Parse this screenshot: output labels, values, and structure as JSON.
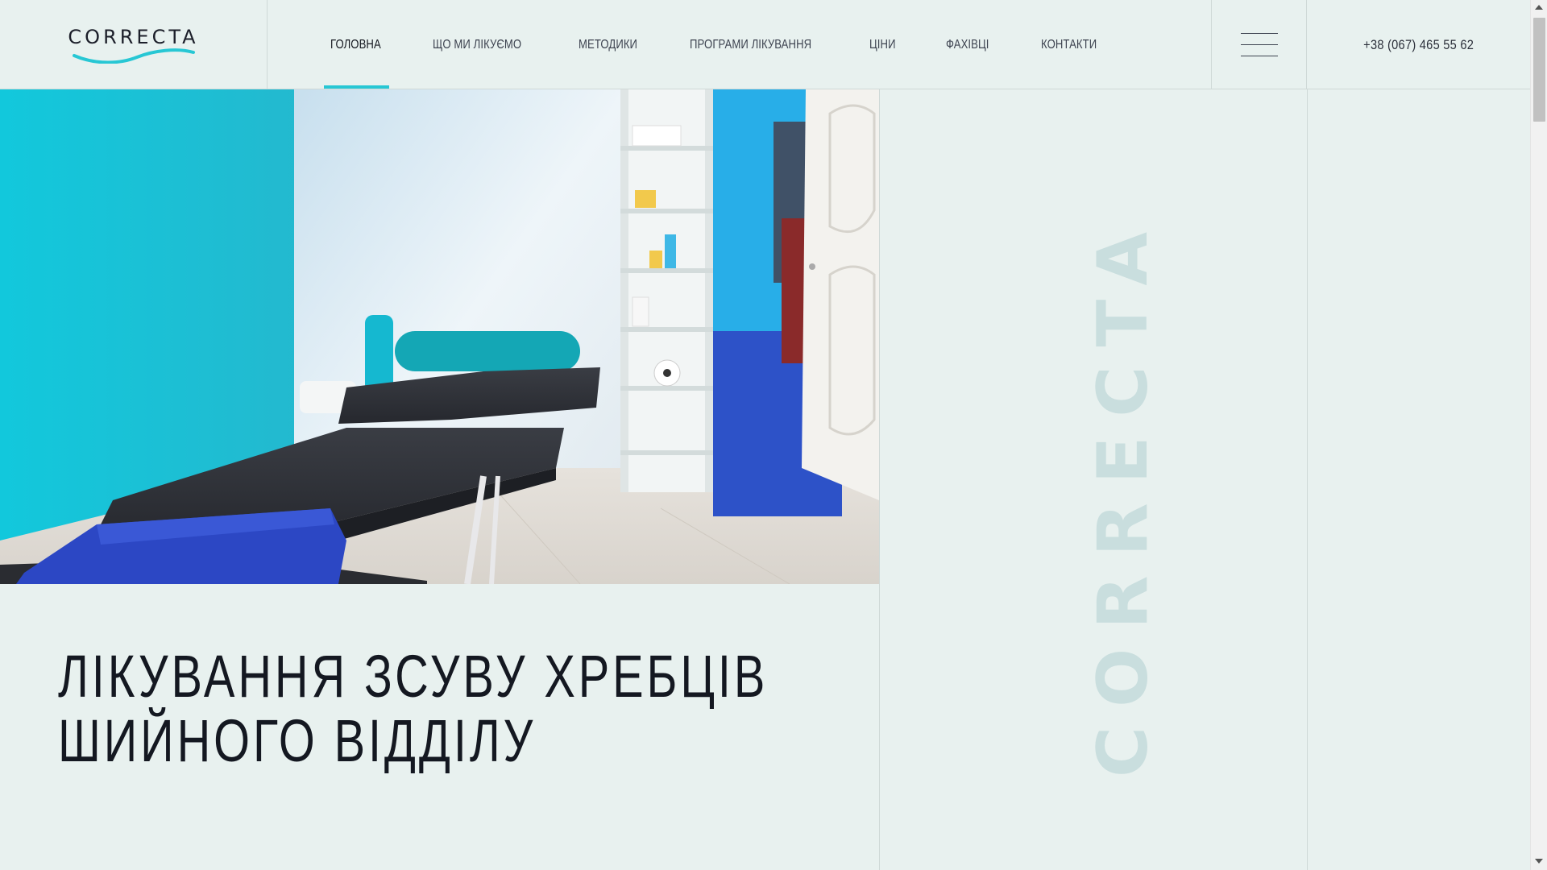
{
  "logo": {
    "text": "CORRECTA",
    "icon": "wave-icon",
    "accent": "#27c7d4"
  },
  "nav": {
    "items": [
      {
        "label": "Головна",
        "active": true
      },
      {
        "label": "Що ми лікуємо"
      },
      {
        "label": "Методики"
      },
      {
        "label": "Програми лікування"
      },
      {
        "label": "Ціни"
      },
      {
        "label": "Фахівці"
      },
      {
        "label": "Контакти"
      }
    ]
  },
  "menu": {
    "icon": "hamburger-icon"
  },
  "contact": {
    "phone": "+38 (067) 465 55 62"
  },
  "hero": {
    "image_alt": "treatment room with massage table",
    "title_line1": "Лікування зсуву хребців",
    "title_line2": "шийного відділу"
  },
  "brand_vertical": "CORRECTA",
  "colors": {
    "background": "#e8f1ef",
    "accent": "#27c7d4",
    "text": "#141821",
    "divider": "#cfd9d7",
    "watermark": "#c9dede"
  }
}
